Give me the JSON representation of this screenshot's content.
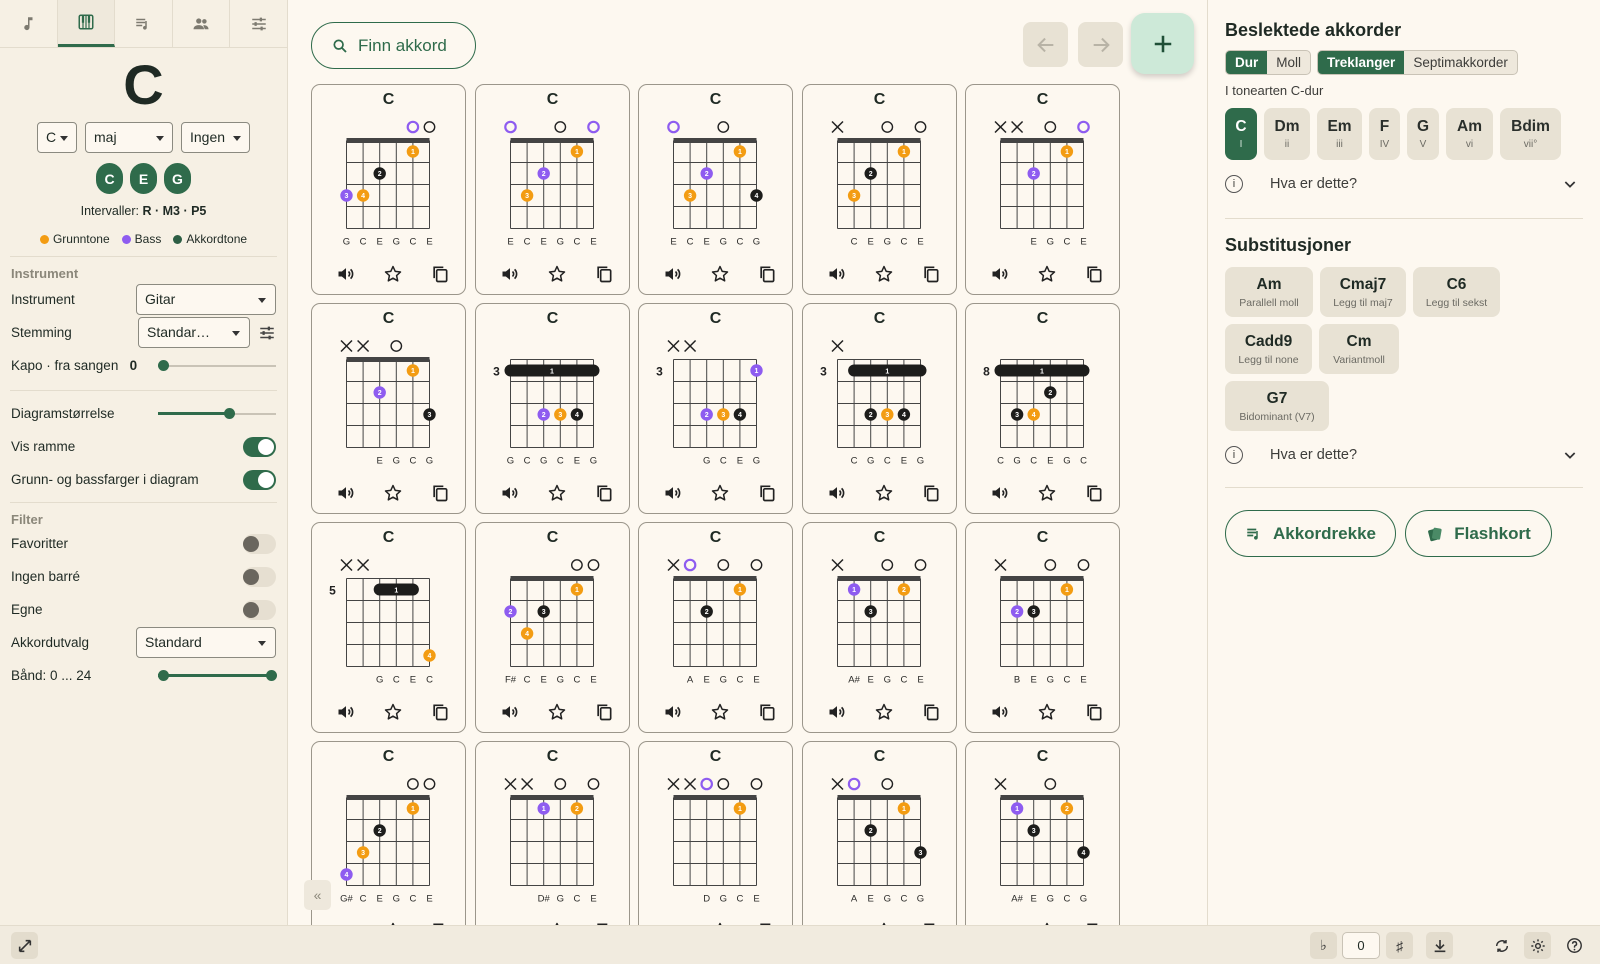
{
  "nav_tabs": [
    {
      "icon": "music-note-icon"
    },
    {
      "icon": "piano-keys-icon"
    },
    {
      "icon": "playlist-icon"
    },
    {
      "icon": "people-icon"
    },
    {
      "icon": "sliders-icon"
    }
  ],
  "chord": {
    "name": "C",
    "root": "C",
    "quality": "maj",
    "bass": "Ingen",
    "notes": [
      "C",
      "E",
      "G"
    ],
    "intervals_label": "Intervaller:",
    "intervals": "R · M3 · P5"
  },
  "legend": [
    {
      "label": "Grunntone",
      "color": "#f39c12"
    },
    {
      "label": "Bass",
      "color": "#8e5cf0"
    },
    {
      "label": "Akkordtone",
      "color": "#2d5e44"
    }
  ],
  "settings": {
    "instrument_section": "Instrument",
    "instrument_label": "Instrument",
    "instrument_value": "Gitar",
    "tuning_label": "Stemming",
    "tuning_value": "Standar…",
    "capo_label": "Kapo · fra sangen",
    "capo_value": "0",
    "diagram_size_label": "Diagramstørrelse",
    "diagram_size_value": 0.6,
    "show_frame_label": "Vis ramme",
    "show_frame": true,
    "colors_label": "Grunn- og bassfarger i diagram",
    "colors": true
  },
  "filter": {
    "section": "Filter",
    "favorites_label": "Favoritter",
    "favorites": false,
    "no_barre_label": "Ingen barré",
    "no_barre": false,
    "own_label": "Egne",
    "own": false,
    "selection_label": "Akkordutvalg",
    "selection_value": "Standard",
    "frets_label": "Bånd: 0 ... 24"
  },
  "toolbar": {
    "find_label": "Finn akkord",
    "back_icon": "arrow-left-icon",
    "forward_icon": "arrow-right-icon",
    "add_icon": "plus-icon"
  },
  "chord_cards": [
    {
      "name": "C",
      "base": 0,
      "top": [
        "",
        "",
        "",
        "",
        "o-b",
        "o"
      ],
      "dots": [
        [
          5,
          1,
          "g",
          "1"
        ],
        [
          3,
          2,
          "k",
          "2"
        ],
        [
          1,
          3,
          "p",
          "3"
        ],
        [
          2,
          3,
          "g",
          "4"
        ]
      ],
      "labels": [
        "G",
        "C",
        "E",
        "G",
        "C",
        "E"
      ]
    },
    {
      "name": "C",
      "base": 0,
      "top": [
        "o-b",
        "",
        "",
        "o",
        "",
        "o-b"
      ],
      "dots": [
        [
          5,
          1,
          "g",
          "1"
        ],
        [
          3,
          2,
          "p",
          "2"
        ],
        [
          2,
          3,
          "g",
          "3"
        ]
      ],
      "labels": [
        "E",
        "C",
        "E",
        "G",
        "C",
        "E"
      ]
    },
    {
      "name": "C",
      "base": 0,
      "top": [
        "o-b",
        "",
        "",
        "o",
        "",
        ""
      ],
      "dots": [
        [
          5,
          1,
          "g",
          "1"
        ],
        [
          3,
          2,
          "p",
          "2"
        ],
        [
          2,
          3,
          "g",
          "3"
        ],
        [
          6,
          3,
          "k",
          "4"
        ]
      ],
      "labels": [
        "E",
        "C",
        "E",
        "G",
        "C",
        "G"
      ]
    },
    {
      "name": "C",
      "base": 0,
      "top": [
        "x",
        "",
        "",
        "o",
        "",
        "o"
      ],
      "dots": [
        [
          5,
          1,
          "g",
          "1"
        ],
        [
          3,
          2,
          "k",
          "2"
        ],
        [
          2,
          3,
          "g",
          "3"
        ]
      ],
      "labels": [
        "",
        "C",
        "E",
        "G",
        "C",
        "E"
      ]
    },
    {
      "name": "C",
      "base": 0,
      "top": [
        "x",
        "x",
        "",
        "o",
        "",
        "o-b"
      ],
      "dots": [
        [
          5,
          1,
          "g",
          "1"
        ],
        [
          3,
          2,
          "p",
          "2"
        ]
      ],
      "labels": [
        "",
        "",
        "E",
        "G",
        "C",
        "E"
      ]
    },
    {
      "name": "C",
      "base": 0,
      "top": [
        "x",
        "x",
        "",
        "o",
        "",
        ""
      ],
      "dots": [
        [
          5,
          1,
          "g",
          "1"
        ],
        [
          3,
          2,
          "p",
          "2"
        ],
        [
          6,
          3,
          "k",
          "3"
        ]
      ],
      "labels": [
        "",
        "",
        "E",
        "G",
        "C",
        "G"
      ]
    },
    {
      "name": "C",
      "base": 3,
      "top": [
        "",
        "",
        "",
        "",
        "",
        ""
      ],
      "barre": [
        1,
        6,
        1
      ],
      "dots": [
        [
          3,
          3,
          "p",
          "2"
        ],
        [
          4,
          3,
          "g",
          "3"
        ],
        [
          5,
          3,
          "k",
          "4"
        ]
      ],
      "labels": [
        "G",
        "C",
        "G",
        "C",
        "E",
        "G"
      ]
    },
    {
      "name": "C",
      "base": 3,
      "top": [
        "x",
        "x",
        "",
        "",
        "",
        ""
      ],
      "dots": [
        [
          6,
          1,
          "p",
          "1"
        ],
        [
          3,
          3,
          "p",
          "2"
        ],
        [
          4,
          3,
          "g",
          "3"
        ],
        [
          5,
          3,
          "k",
          "4"
        ]
      ],
      "labels": [
        "",
        "",
        "G",
        "C",
        "E",
        "G"
      ]
    },
    {
      "name": "C",
      "base": 3,
      "top": [
        "x",
        "",
        "",
        "",
        "",
        ""
      ],
      "barre": [
        2,
        6,
        1
      ],
      "dots": [
        [
          3,
          3,
          "k",
          "2"
        ],
        [
          4,
          3,
          "g",
          "3"
        ],
        [
          5,
          3,
          "k",
          "4"
        ]
      ],
      "labels": [
        "",
        "C",
        "G",
        "C",
        "E",
        "G"
      ]
    },
    {
      "name": "C",
      "base": 8,
      "top": [
        "",
        "",
        "",
        "",
        "",
        ""
      ],
      "barre": [
        1,
        6,
        1
      ],
      "dots": [
        [
          4,
          2,
          "k",
          "2"
        ],
        [
          2,
          3,
          "k",
          "3"
        ],
        [
          3,
          3,
          "g",
          "4"
        ]
      ],
      "labels": [
        "C",
        "G",
        "C",
        "E",
        "G",
        "C"
      ]
    },
    {
      "name": "C",
      "base": 5,
      "top": [
        "x",
        "x",
        "",
        "",
        "",
        ""
      ],
      "barre": [
        3,
        5,
        1
      ],
      "dots": [
        [
          6,
          4,
          "g",
          "4"
        ]
      ],
      "labels": [
        "",
        "",
        "G",
        "C",
        "E",
        "C"
      ]
    },
    {
      "name": "C",
      "base": 0,
      "top": [
        "",
        "",
        "",
        "",
        "o",
        "o"
      ],
      "dots": [
        [
          5,
          1,
          "g",
          "1"
        ],
        [
          1,
          2,
          "p",
          "2"
        ],
        [
          3,
          2,
          "k",
          "3"
        ],
        [
          2,
          3,
          "g",
          "4"
        ]
      ],
      "labels": [
        "F#",
        "C",
        "E",
        "G",
        "C",
        "E"
      ]
    },
    {
      "name": "C",
      "base": 0,
      "top": [
        "x",
        "o-b",
        "",
        "o",
        "",
        "o"
      ],
      "dots": [
        [
          5,
          1,
          "g",
          "1"
        ],
        [
          3,
          2,
          "k",
          "2"
        ]
      ],
      "labels": [
        "",
        "A",
        "E",
        "G",
        "C",
        "E"
      ]
    },
    {
      "name": "C",
      "base": 0,
      "top": [
        "x",
        "",
        "",
        "o",
        "",
        "o"
      ],
      "dots": [
        [
          2,
          1,
          "p",
          "1"
        ],
        [
          5,
          1,
          "g",
          "2"
        ],
        [
          3,
          2,
          "k",
          "3"
        ]
      ],
      "labels": [
        "",
        "A#",
        "E",
        "G",
        "C",
        "E"
      ]
    },
    {
      "name": "C",
      "base": 0,
      "top": [
        "x",
        "",
        "",
        "o",
        "",
        "o"
      ],
      "dots": [
        [
          5,
          1,
          "g",
          "1"
        ],
        [
          2,
          2,
          "p",
          "2"
        ],
        [
          3,
          2,
          "k",
          "3"
        ]
      ],
      "labels": [
        "",
        "B",
        "E",
        "G",
        "C",
        "E"
      ]
    },
    {
      "name": "C",
      "base": 0,
      "top": [
        "",
        "",
        "",
        "",
        "o",
        "o"
      ],
      "dots": [
        [
          5,
          1,
          "g",
          "1"
        ],
        [
          3,
          2,
          "k",
          "2"
        ],
        [
          2,
          3,
          "g",
          "3"
        ],
        [
          1,
          4,
          "p",
          "4"
        ]
      ],
      "labels": [
        "G#",
        "C",
        "E",
        "G",
        "C",
        "E"
      ]
    },
    {
      "name": "C",
      "base": 0,
      "top": [
        "x",
        "x",
        "",
        "o",
        "",
        "o"
      ],
      "dots": [
        [
          3,
          1,
          "p",
          "1"
        ],
        [
          5,
          1,
          "g",
          "2"
        ]
      ],
      "labels": [
        "",
        "",
        "D#",
        "G",
        "C",
        "E"
      ]
    },
    {
      "name": "C",
      "base": 0,
      "top": [
        "x",
        "x",
        "o-b",
        "o",
        "",
        "o"
      ],
      "dots": [
        [
          5,
          1,
          "g",
          "1"
        ]
      ],
      "labels": [
        "",
        "",
        "D",
        "G",
        "C",
        "E"
      ]
    },
    {
      "name": "C",
      "base": 0,
      "top": [
        "x",
        "o-b",
        "",
        "o",
        "",
        ""
      ],
      "dots": [
        [
          5,
          1,
          "g",
          "1"
        ],
        [
          3,
          2,
          "k",
          "2"
        ],
        [
          6,
          3,
          "k",
          "3"
        ]
      ],
      "labels": [
        "",
        "A",
        "E",
        "G",
        "C",
        "G"
      ]
    },
    {
      "name": "C",
      "base": 0,
      "top": [
        "x",
        "",
        "",
        "o",
        "",
        ""
      ],
      "dots": [
        [
          2,
          1,
          "p",
          "1"
        ],
        [
          5,
          1,
          "g",
          "2"
        ],
        [
          3,
          2,
          "k",
          "3"
        ],
        [
          6,
          3,
          "k",
          "4"
        ]
      ],
      "labels": [
        "",
        "A#",
        "E",
        "G",
        "C",
        "G"
      ]
    }
  ],
  "related": {
    "title": "Beslektede akkorder",
    "mode_options": [
      "Dur",
      "Moll"
    ],
    "mode_selected": "Dur",
    "type_options": [
      "Treklanger",
      "Septimakkorder"
    ],
    "type_selected": "Treklanger",
    "key_label": "I tonearten C-dur",
    "chords": [
      {
        "name": "C",
        "degree": "I",
        "selected": true
      },
      {
        "name": "Dm",
        "degree": "ii"
      },
      {
        "name": "Em",
        "degree": "iii"
      },
      {
        "name": "F",
        "degree": "IV"
      },
      {
        "name": "G",
        "degree": "V"
      },
      {
        "name": "Am",
        "degree": "vi"
      },
      {
        "name": "Bdim",
        "degree": "vii°"
      }
    ],
    "help_label": "Hva er dette?"
  },
  "substitutions": {
    "title": "Substitusjoner",
    "items": [
      {
        "name": "Am",
        "desc": "Parallell moll"
      },
      {
        "name": "Cmaj7",
        "desc": "Legg til maj7"
      },
      {
        "name": "C6",
        "desc": "Legg til sekst"
      },
      {
        "name": "Cadd9",
        "desc": "Legg til none"
      },
      {
        "name": "Cm",
        "desc": "Variantmoll"
      },
      {
        "name": "G7",
        "desc": "Bidominant (V7)"
      }
    ],
    "help_label": "Hva er dette?"
  },
  "actions": {
    "progression_label": "Akkordrekke",
    "flashcards_label": "Flashkort"
  },
  "bottom_bar": {
    "expand_icon": "expand-icon",
    "flat_label": "♭",
    "transpose_value": "0",
    "sharp_label": "♯",
    "download_icon": "download-icon",
    "sync_icon": "sync-icon",
    "settings_icon": "gear-icon",
    "help_icon": "help-icon"
  }
}
